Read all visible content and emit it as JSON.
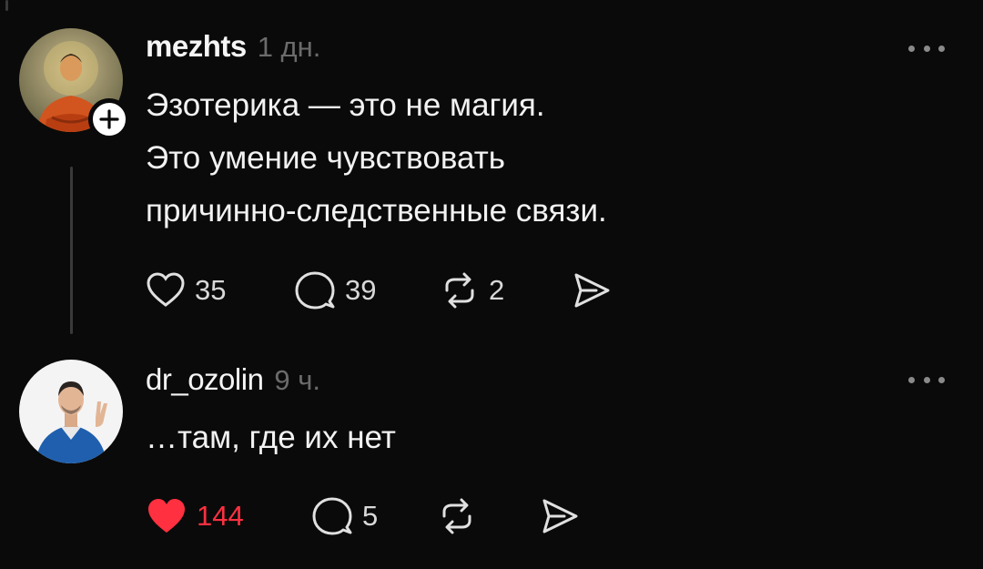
{
  "posts": [
    {
      "username": "mezhts",
      "time": "1 дн.",
      "lines": [
        "Эзотерика — это не магия.",
        "Это умение чувствовать",
        "причинно-следственные связи."
      ],
      "likes": "35",
      "comments": "39",
      "reposts": "2",
      "liked": false
    },
    {
      "username": "dr_ozolin",
      "time": "9 ч.",
      "lines": [
        "…там, где их нет"
      ],
      "likes": "144",
      "comments": "5",
      "reposts": "",
      "liked": true
    }
  ],
  "icons": {
    "like": "heart-icon",
    "comment": "speech-bubble-icon",
    "repost": "repost-icon",
    "share": "send-icon",
    "more": "more-icon",
    "follow": "plus-icon"
  },
  "colors": {
    "background": "#0a0a0a",
    "text": "#f2f2f2",
    "muted": "#6b6b6b",
    "like_active": "#ff3040"
  }
}
